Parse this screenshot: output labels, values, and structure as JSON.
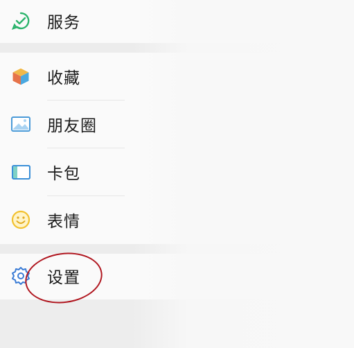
{
  "menu": {
    "items": [
      {
        "label": "服务",
        "icon": "service-icon"
      },
      {
        "label": "收藏",
        "icon": "favorites-icon"
      },
      {
        "label": "朋友圈",
        "icon": "moments-icon"
      },
      {
        "label": "卡包",
        "icon": "card-wallet-icon"
      },
      {
        "label": "表情",
        "icon": "sticker-icon"
      },
      {
        "label": "设置",
        "icon": "settings-icon"
      }
    ]
  },
  "colors": {
    "service": "#2ab36b",
    "favorites": "#e8a33d",
    "moments": "#4a9ad8",
    "card": "#3a8fd8",
    "sticker": "#f2c12e",
    "settings": "#3a7bd5",
    "annotation": "#b0161f"
  }
}
